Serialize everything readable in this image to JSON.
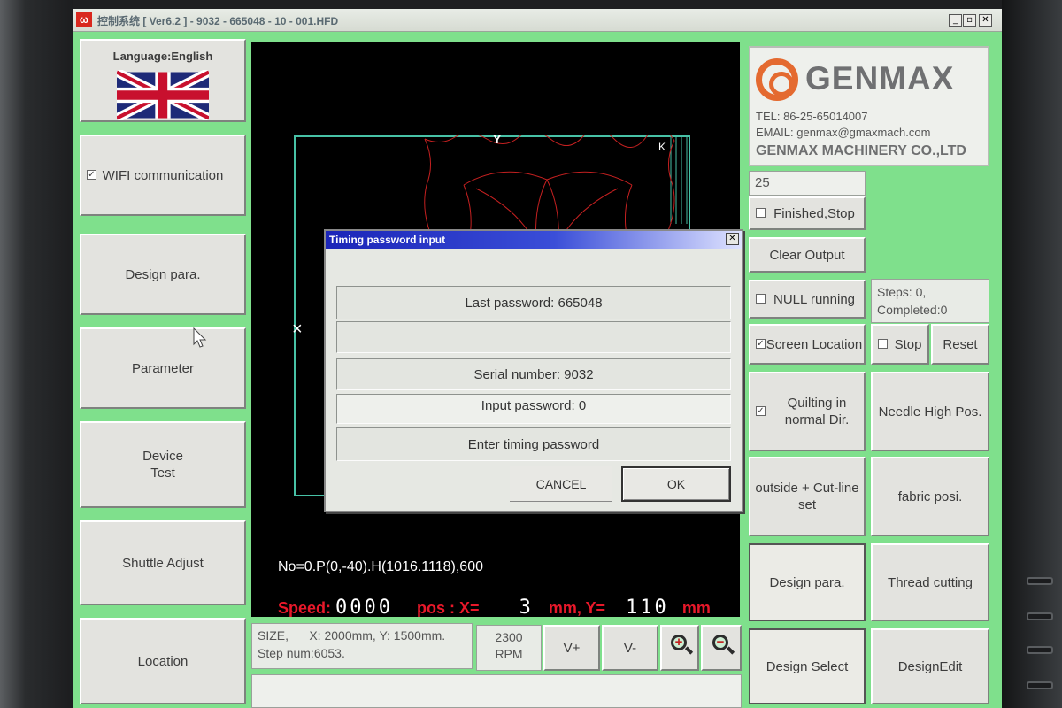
{
  "window": {
    "title": "控制系统 [ Ver6.2 ] - 9032 - 665048 - 10 - 001.HFD",
    "min_glyph": "_",
    "max_glyph": "▫",
    "close_glyph": "✕"
  },
  "left_panel": {
    "language_label": "Language:English",
    "wifi_label": "WIFI communication",
    "wifi_checked": true,
    "design_para_label": "Design para.",
    "parameter_label": "Parameter",
    "device_test_label": "Device\nTest",
    "shuttle_adjust_label": "Shuttle Adjust",
    "location_label": "Location"
  },
  "canvas": {
    "marker_y": "Y",
    "marker_k": "K",
    "marker_x": "×",
    "status_text": "No=0.P(0,-40).H(1016.1118),600",
    "speed_label": "Speed:",
    "speed_value": "0000",
    "pos_label": "pos : X=",
    "pos_x": "3",
    "pos_y_label": "mm, Y=",
    "pos_y": "110",
    "mm_label": "mm"
  },
  "dialog": {
    "title": "Timing password input",
    "last_password": "Last password: 665048",
    "serial_number": "Serial number: 9032",
    "input_password": "Input password: 0",
    "enter_label": "Enter timing password",
    "cancel_label": "CANCEL",
    "ok_label": "OK",
    "close_glyph": "✕"
  },
  "logo": {
    "brand": "GENMAX",
    "tel": "TEL: 86-25-65014007",
    "email": "EMAIL: genmax@gmaxmach.com",
    "company": "GENMAX MACHINERY CO.,LTD"
  },
  "right_panel": {
    "counter_value": "25",
    "finished_stop_label": "Finished,Stop",
    "finished_stop_checked": false,
    "clear_output_label": "Clear Output",
    "null_running_label": "NULL running",
    "null_running_checked": false,
    "steps_text": "Steps:    0,",
    "completed_text": "Completed:0",
    "screen_location_label": "Screen Location",
    "screen_location_checked": true,
    "stop_label": "Stop",
    "stop_checked": false,
    "reset_label": "Reset",
    "quilting_label": "Quilting in\nnormal Dir.",
    "quilting_checked": true,
    "needle_high_label": "Needle High Pos.",
    "outside_cutline_label": "outside + Cut-line\nset",
    "fabric_posi_label": "fabric posi.",
    "design_para_label": "Design para.",
    "thread_cutting_label": "Thread cutting",
    "design_select_label": "Design Select",
    "design_edit_label": "DesignEdit"
  },
  "bottom_bar": {
    "size_text": "SIZE,      X: 2000mm, Y: 1500mm.",
    "step_num_text": "Step num:6053.",
    "rpm_value": "2300",
    "rpm_unit": "RPM",
    "v_plus_label": "V+",
    "v_minus_label": "V-"
  },
  "colors": {
    "screen_bg": "#7fe08c",
    "canvas_bg": "#000000",
    "frame_line": "#47c1a6",
    "design_line": "#c42020",
    "speed_text": "#e8182a",
    "dialog_title": "#1b25b8",
    "logo_orange": "#e46a30"
  }
}
